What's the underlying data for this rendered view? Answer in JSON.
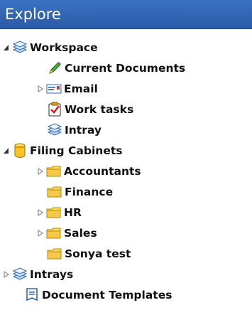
{
  "panel": {
    "title": "Explore"
  },
  "tree": {
    "workspace": "Workspace",
    "current_documents": "Current Documents",
    "email": "Email",
    "work_tasks": "Work tasks",
    "intray": "Intray",
    "filing_cabinets": "Filing Cabinets",
    "accountants": "Accountants",
    "finance": "Finance",
    "hr": "HR",
    "sales": "Sales",
    "sonya_test": "Sonya test",
    "intrays": "Intrays",
    "document_templates": "Document Templates"
  },
  "colors": {
    "header": "#2f63b3",
    "folder": "#f6c94a",
    "cabinet": "#f0b400"
  },
  "icons": {
    "workspace": "stack-icon",
    "current_documents": "pencil-icon",
    "email": "email-icon",
    "work_tasks": "task-icon",
    "intray": "stack-icon",
    "filing_cabinets": "cabinet-icon",
    "folders": "folder-icon",
    "intrays": "stack-icon",
    "document_templates": "template-icon"
  }
}
